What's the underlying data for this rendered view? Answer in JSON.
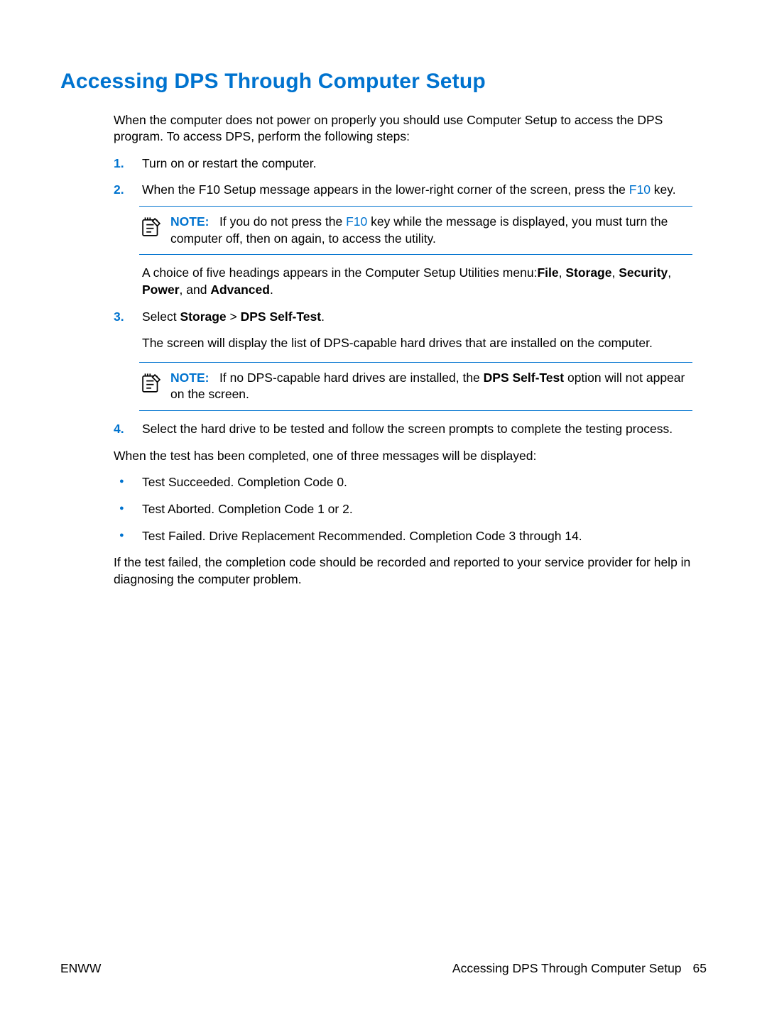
{
  "title": "Accessing DPS Through Computer Setup",
  "intro": "When the computer does not power on properly you should use Computer Setup to access the DPS program. To access DPS, perform the following steps:",
  "steps": {
    "s1": {
      "num": "1.",
      "text": "Turn on or restart the computer."
    },
    "s2": {
      "num": "2.",
      "text_a": "When the F10 Setup message appears in the lower-right corner of the screen, press the ",
      "link": "F10",
      "text_b": " key.",
      "note_label": "NOTE:",
      "note_a": "If you do not press the ",
      "note_link": "F10",
      "note_b": " key while the message is displayed, you must turn the computer off, then on again, to access the utility.",
      "after_a": "A choice of five headings appears in the Computer Setup Utilities menu:",
      "after_b1": "File",
      "after_c": ", ",
      "after_b2": "Storage",
      "after_d": ", ",
      "after_b3": "Security",
      "after_e": ", ",
      "after_b4": "Power",
      "after_f": ", and ",
      "after_b5": "Advanced",
      "after_g": "."
    },
    "s3": {
      "num": "3.",
      "text_a": "Select ",
      "b1": "Storage",
      "text_b": " > ",
      "b2": "DPS Self-Test",
      "text_c": ".",
      "after": "The screen will display the list of DPS-capable hard drives that are installed on the computer.",
      "note_label": "NOTE:",
      "note_a": "If no DPS-capable hard drives are installed, the ",
      "note_b1": "DPS Self-Test",
      "note_b": " option will not appear on the screen."
    },
    "s4": {
      "num": "4.",
      "text": "Select the hard drive to be tested and follow the screen prompts to complete the testing process."
    }
  },
  "completed_intro": "When the test has been completed, one of three messages will be displayed:",
  "bullets": {
    "b1": "Test Succeeded. Completion Code 0.",
    "b2": "Test Aborted. Completion Code 1 or 2.",
    "b3": "Test Failed. Drive Replacement Recommended. Completion Code 3 through 14."
  },
  "outro": "If the test failed, the completion code should be recorded and reported to your service provider for help in diagnosing the computer problem.",
  "footer": {
    "left": "ENWW",
    "right_label": "Accessing DPS Through Computer Setup",
    "page": "65"
  }
}
